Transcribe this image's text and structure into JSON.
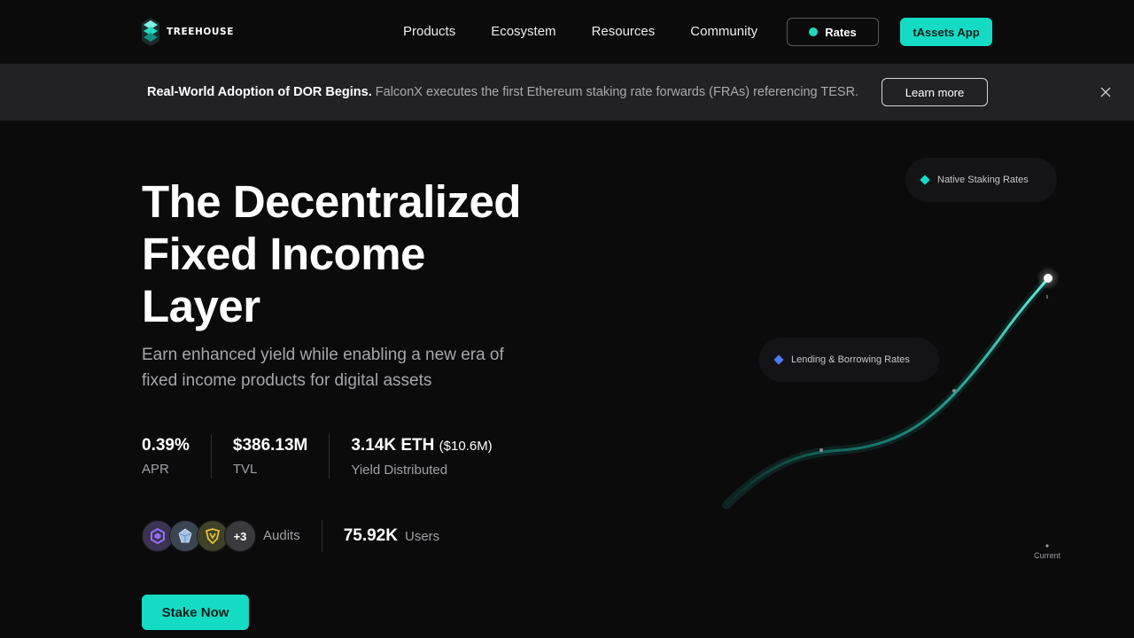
{
  "brand": {
    "name": "TREEHOUSE"
  },
  "nav": {
    "links": [
      "Products",
      "Ecosystem",
      "Resources",
      "Community"
    ],
    "rates_label": "Rates",
    "app_label": "tAssets App"
  },
  "banner": {
    "headline": "Real-World Adoption of DOR Begins.",
    "body": "FalconX executes the first Ethereum staking rate forwards (FRAs) referencing TESR.",
    "cta": "Learn more"
  },
  "hero": {
    "title_lines": [
      "The Decentralized",
      "Fixed Income",
      "Layer"
    ],
    "subtitle": "Earn enhanced yield while enabling a new era of fixed income products for digital assets",
    "stats": [
      {
        "value": "0.39%",
        "label": "APR"
      },
      {
        "value": "$386.13M",
        "label": "TVL"
      },
      {
        "value": "3.14K ETH",
        "extra": "($10.6M)",
        "label": "Yield Distributed"
      }
    ],
    "audits": {
      "icons": [
        "audit-firm-hexagon-icon",
        "audit-firm-crystal-icon",
        "audit-firm-shield-icon"
      ],
      "more": "+3",
      "label": "Audits"
    },
    "users": {
      "value": "75.92K",
      "label": "Users"
    },
    "cta": "Stake Now"
  },
  "illustration": {
    "pills": [
      {
        "label": "Native Staking Rates",
        "color": "#14dcc4"
      },
      {
        "label": "Lending & Borrowing Rates",
        "color": "#4b7bf5"
      }
    ],
    "current_label": "Current"
  },
  "colors": {
    "accent": "#14dcc4",
    "background": "#0b0b0c",
    "banner_bg": "#222226",
    "lending_accent": "#4b7bf5"
  }
}
